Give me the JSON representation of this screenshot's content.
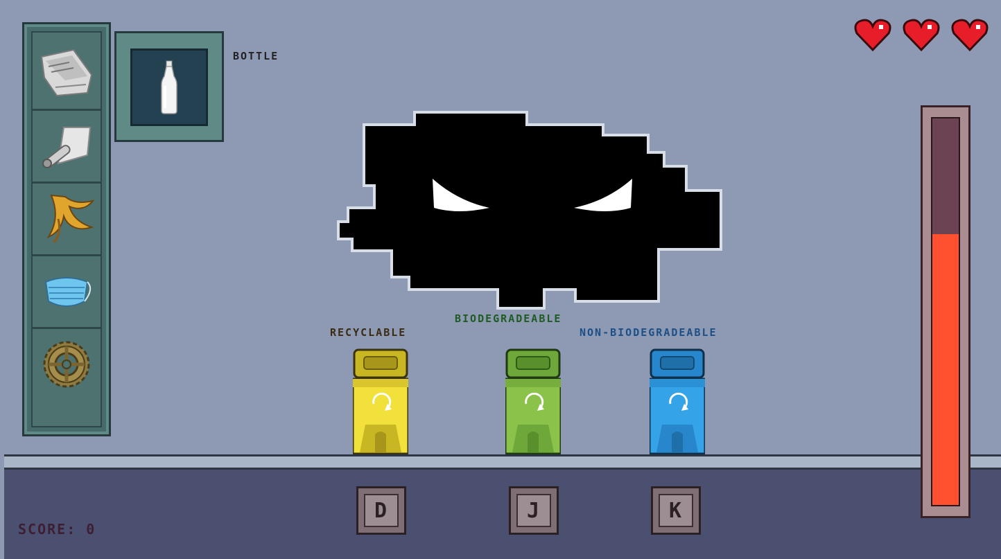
{
  "current_item": {
    "label": "BOTTLE",
    "icon": "bottle-icon"
  },
  "queue": [
    {
      "icon": "newspaper-icon"
    },
    {
      "icon": "aluminium-foil-icon"
    },
    {
      "icon": "banana-peel-icon"
    },
    {
      "icon": "face-mask-icon"
    },
    {
      "icon": "gear-icon"
    }
  ],
  "lives": 3,
  "health_fraction": 0.7,
  "score_text": "SCORE: 0",
  "bins": [
    {
      "label": "RECYCLABLE",
      "key": "D",
      "color": "#f2e13b",
      "label_color": "#3a2b14"
    },
    {
      "label": "BIODEGRADEABLE",
      "key": "J",
      "color": "#8ac24a",
      "label_color": "#1f5b22"
    },
    {
      "label": "NON-BIODEGRADEABLE",
      "key": "K",
      "color": "#34a3e8",
      "label_color": "#1c4f86"
    }
  ],
  "colors": {
    "background": "#8e99b4",
    "health": "#ff5130",
    "heart": "#e81d2a"
  }
}
